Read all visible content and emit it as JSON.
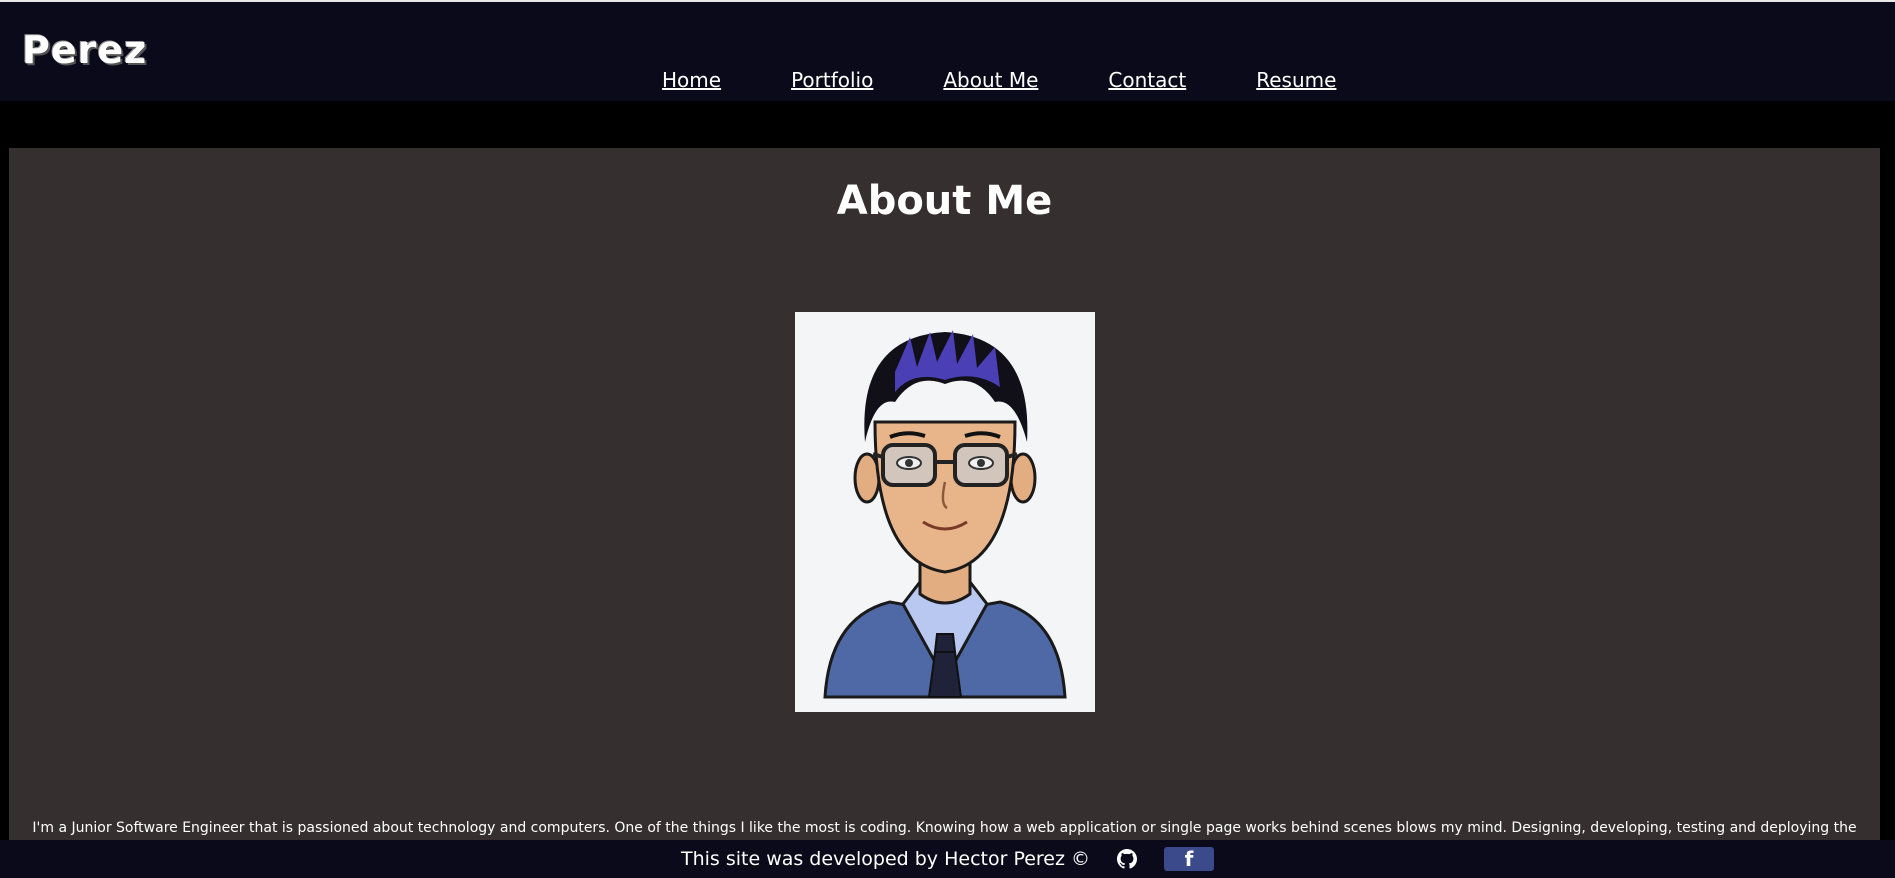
{
  "header": {
    "logo": "Perez",
    "nav": [
      {
        "label": "Home"
      },
      {
        "label": "Portfolio"
      },
      {
        "label": "About Me"
      },
      {
        "label": "Contact"
      },
      {
        "label": "Resume"
      }
    ]
  },
  "main": {
    "title": "About Me",
    "avatar_icon": "cartoon-avatar-man-glasses",
    "bio": "I'm a Junior Software Engineer that is passioned about technology and computers. One of the things I like the most is coding. Knowing how a web application or single page works behind scenes blows my mind. Designing, developing, testing and deploying the"
  },
  "footer": {
    "text": "This site was developed by Hector Perez ©",
    "icons": [
      "github-icon",
      "facebook-icon"
    ],
    "facebook_glyph": "f"
  },
  "colors": {
    "header_bg": "#0a0a1a",
    "page_bg": "#000000",
    "panel_bg": "#352f2f",
    "footer_bg": "#0a0a1a",
    "facebook_bg": "#3b4a8a",
    "text": "#ffffff"
  }
}
